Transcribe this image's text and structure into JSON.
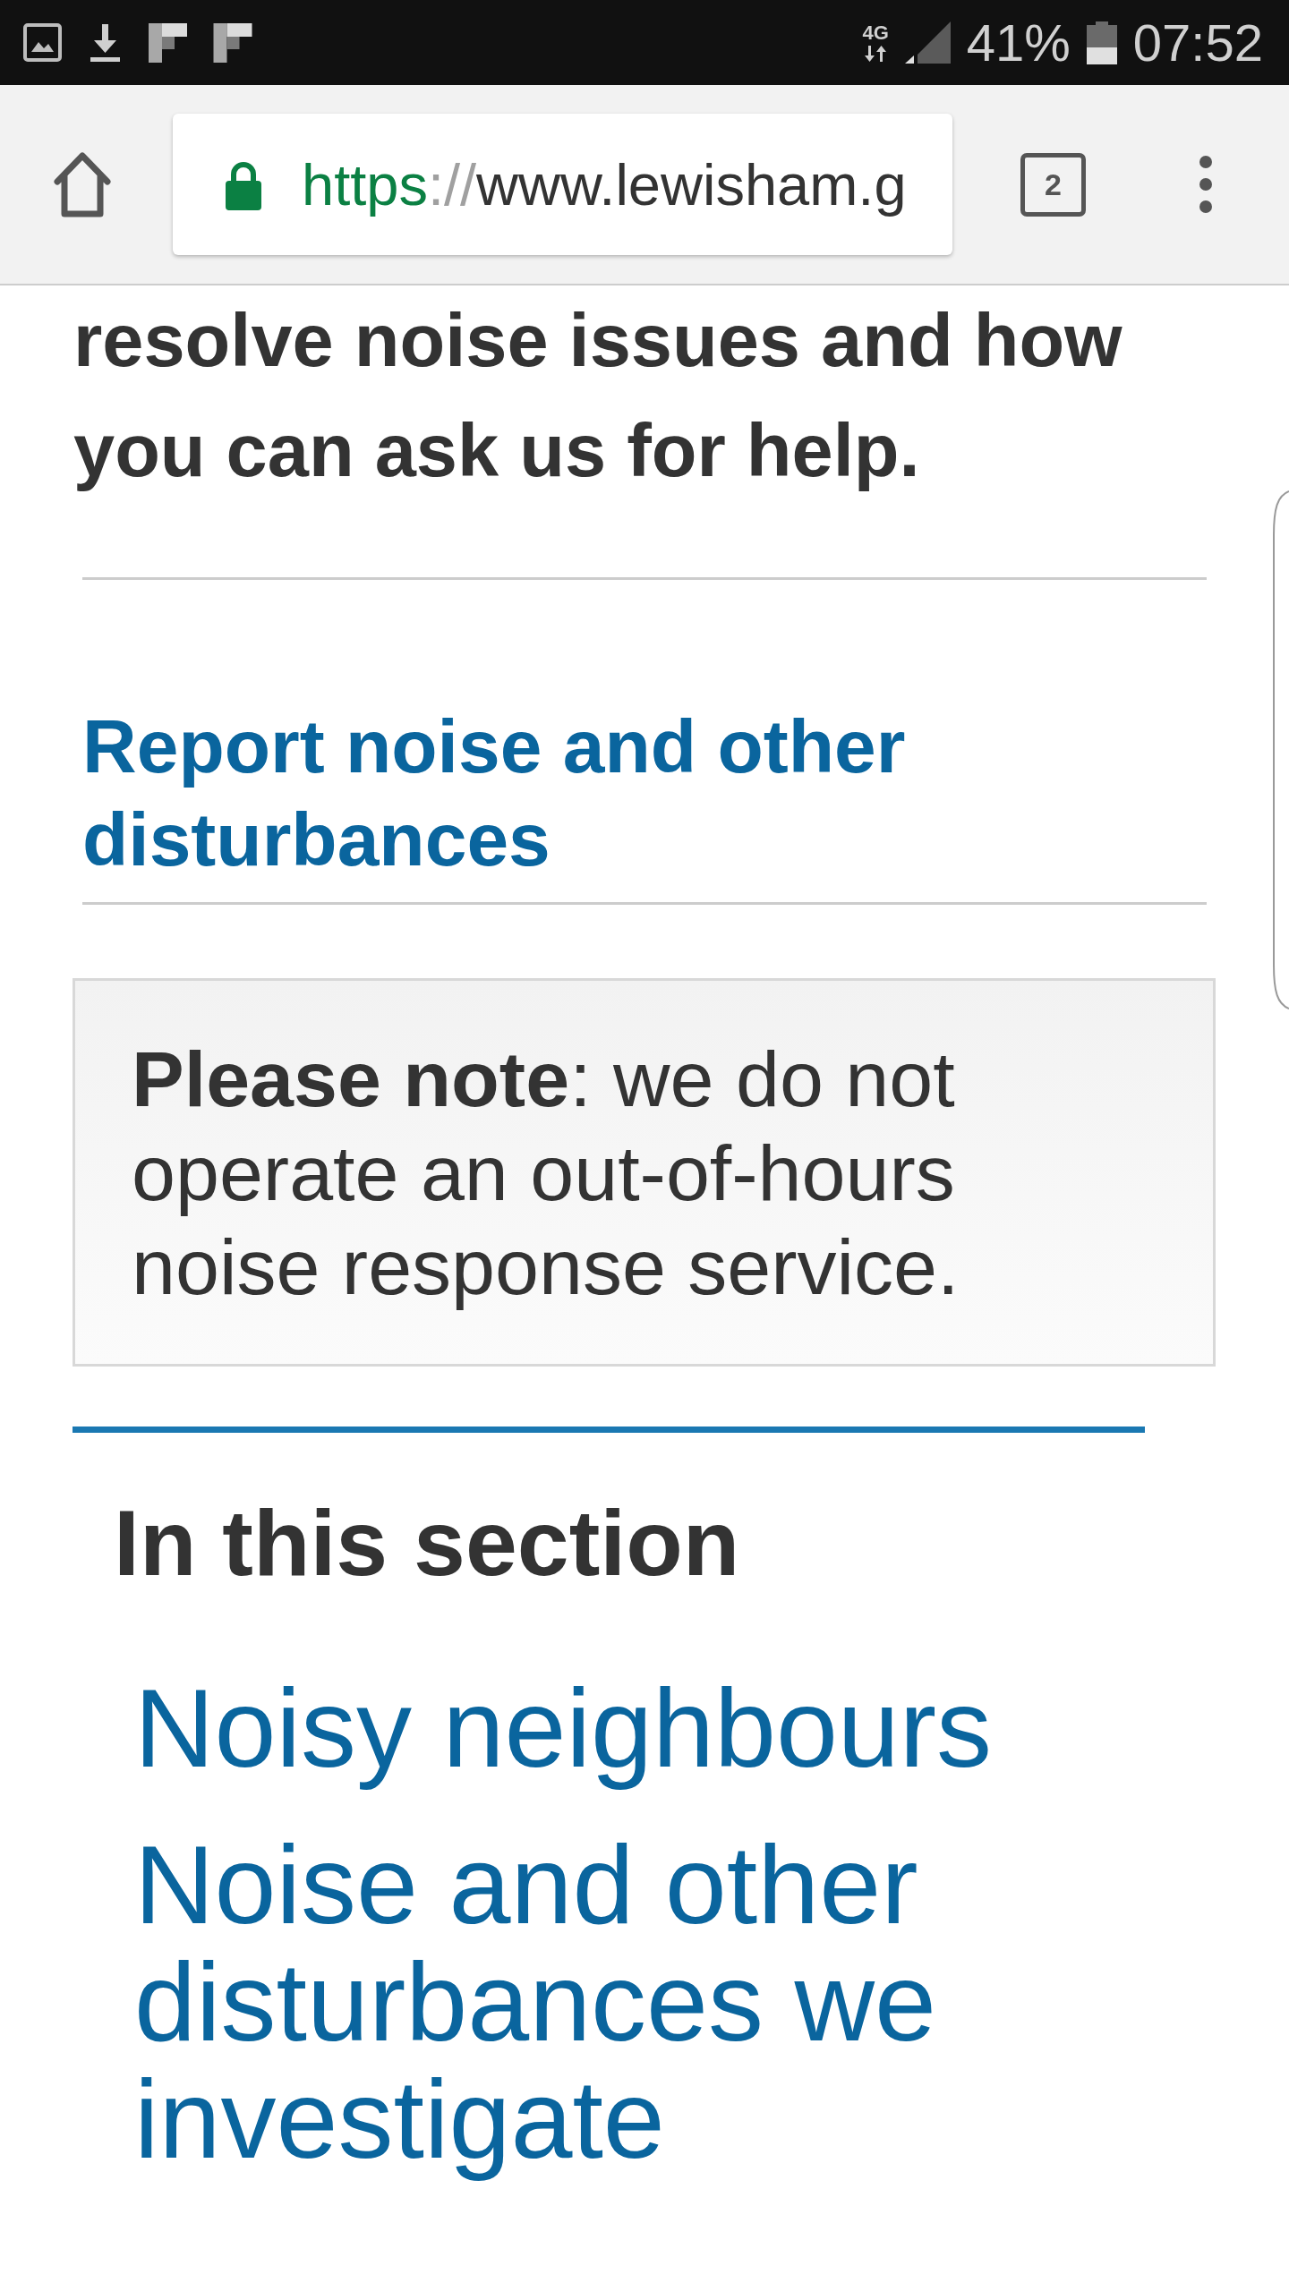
{
  "status_bar": {
    "network_type": "4G",
    "battery_percent": "41%",
    "time": "07:52"
  },
  "browser_toolbar": {
    "secure": true,
    "url": {
      "scheme": "https",
      "separator": "://",
      "host": "www.lewisham.g"
    },
    "tab_count": "2"
  },
  "article": {
    "intro_tail": "resolve noise issues and how you can ask us for help.",
    "report_link": "Report noise and other disturbances",
    "note": "**Please note**: we do not operate an out-of-hours noise response service."
  },
  "section_nav": {
    "heading": "In this section",
    "links": [
      "Noisy neighbours",
      "Noise and other disturbances we investigate"
    ]
  }
}
